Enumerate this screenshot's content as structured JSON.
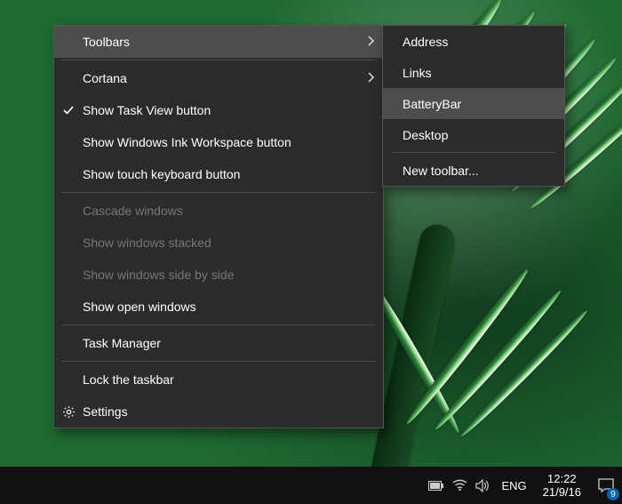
{
  "main_menu": {
    "toolbars": "Toolbars",
    "cortana": "Cortana",
    "show_task_view": "Show Task View button",
    "show_ink": "Show Windows Ink Workspace button",
    "show_touch_kb": "Show touch keyboard button",
    "cascade": "Cascade windows",
    "stacked": "Show windows stacked",
    "sidebyside": "Show windows side by side",
    "open_windows": "Show open windows",
    "task_manager": "Task Manager",
    "lock_taskbar": "Lock the taskbar",
    "settings": "Settings"
  },
  "toolbars_submenu": {
    "address": "Address",
    "links": "Links",
    "batterybar": "BatteryBar",
    "desktop": "Desktop",
    "new_toolbar": "New toolbar..."
  },
  "taskbar": {
    "language": "ENG",
    "time": "12:22",
    "date": "21/9/16",
    "notif_count": "9"
  }
}
